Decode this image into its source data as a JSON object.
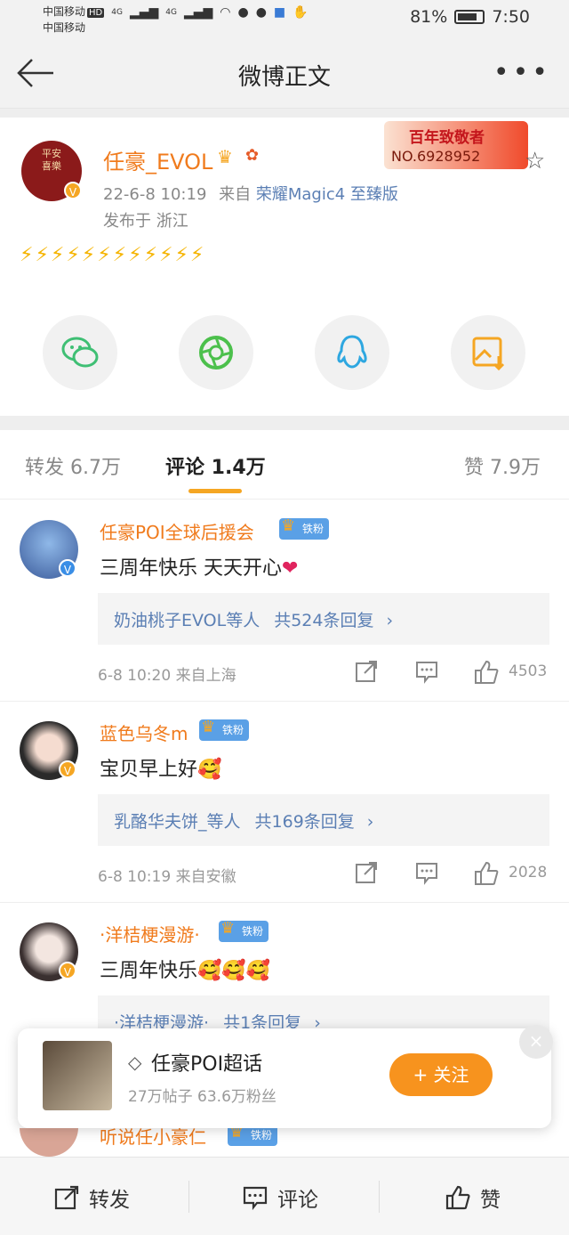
{
  "status_bar": {
    "carrier_1": "中国移动",
    "carrier_2": "中国移动",
    "hd": "HD",
    "network_1": "4G",
    "network_2": "4G",
    "battery": "81%",
    "battery_level": 0.81,
    "time": "7:50"
  },
  "nav": {
    "title": "微博正文"
  },
  "post": {
    "author": "任豪_EVOL",
    "avatar_text": "平安喜樂",
    "time": "22-6-8 10:19",
    "source_prefix": "来自",
    "device": "荣耀Magic4 至臻版",
    "location": "发布于 浙江",
    "badge_title": "百年致敬者",
    "badge_no": "NO.6928952",
    "text": "⚡⚡⚡⚡⚡⚡⚡⚡⚡⚡⚡⚡",
    "share_icons": [
      "wechat-icon",
      "moments-icon",
      "qq-icon",
      "save-image-icon"
    ]
  },
  "tabs": {
    "repost": "转发 6.7万",
    "comment": "评论 1.4万",
    "like": "赞 7.9万"
  },
  "comments": [
    {
      "name": "任豪POI全球后援会",
      "fan": "铁粉",
      "text": "三周年快乐  天天开心",
      "emoji": "❤",
      "reply_user": "奶油桃子EVOL等人",
      "reply_count": "共524条回复",
      "time": "6-8 10:20  来自上海",
      "likes": "4503"
    },
    {
      "name": "蓝色乌冬m",
      "fan": "铁粉",
      "text": "宝贝早上好",
      "emoji": "🥰",
      "reply_user": "乳酪华夫饼_等人",
      "reply_count": "共169条回复",
      "time": "6-8 10:19  来自安徽",
      "likes": "2028"
    },
    {
      "name": "·洋桔梗漫游·",
      "fan": "铁粉",
      "text": "三周年快乐",
      "emoji": "🥰🥰🥰",
      "reply_user": "·洋桔梗漫游·",
      "reply_count": "共1条回复"
    }
  ],
  "peek": {
    "name": "听说任小豪仁",
    "fan": "铁粉"
  },
  "popup": {
    "title": "任豪POI超话",
    "stats": "27万帖子  63.6万粉丝",
    "follow": "+ 关注",
    "close": "×"
  },
  "bottom_bar": {
    "repost": "转发",
    "comment": "评论",
    "like": "赞"
  },
  "colors": {
    "accent": "#f7931e",
    "username": "#f07b1d",
    "link": "#5b7fb4"
  }
}
